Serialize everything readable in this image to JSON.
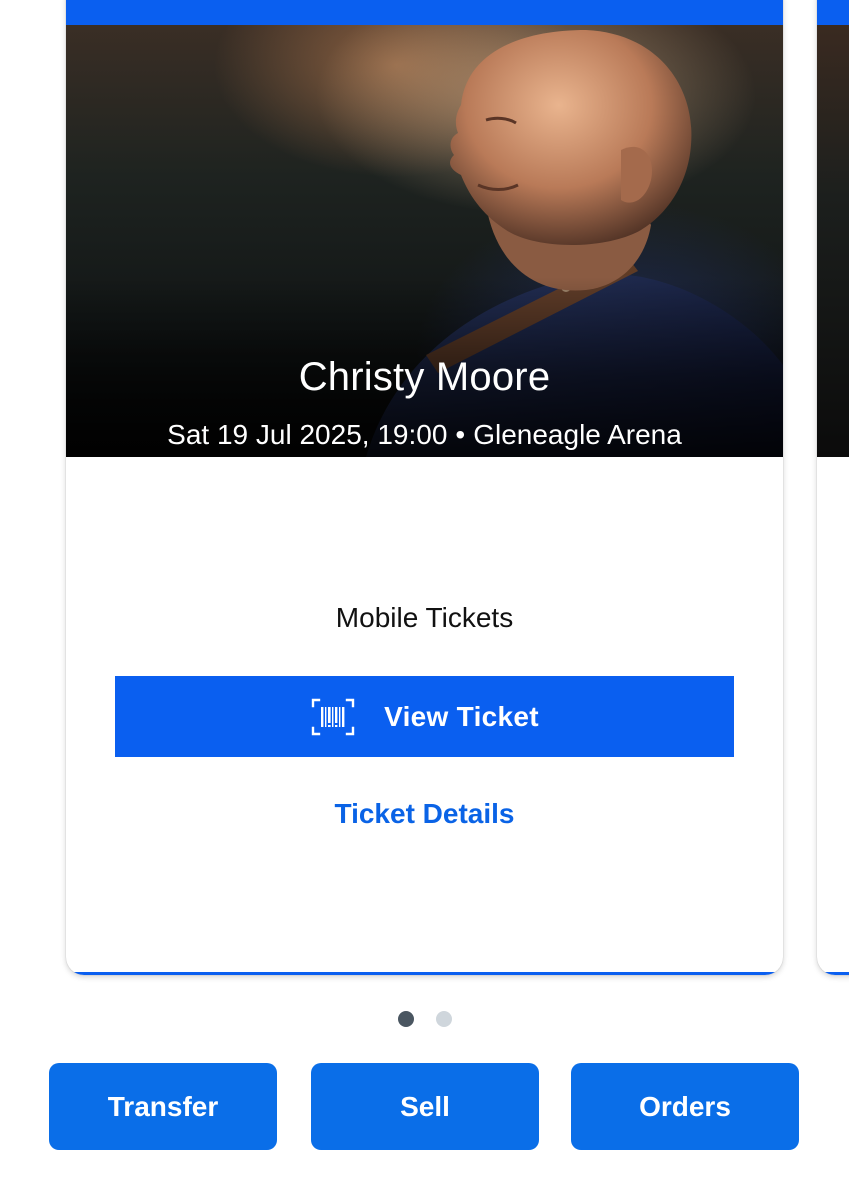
{
  "event": {
    "title": "Christy Moore",
    "datetime": "Sat 19 Jul 2025, 19:00",
    "separator": "•",
    "venue": "Gleneagle Arena"
  },
  "ticket": {
    "type_label": "Mobile Tickets",
    "view_button_label": "View Ticket",
    "view_button_icon": "barcode-scan-icon",
    "details_link_label": "Ticket Details"
  },
  "pager": {
    "current_page": 1,
    "total_pages": 2
  },
  "actions": {
    "transfer_label": "Transfer",
    "sell_label": "Sell",
    "orders_label": "Orders"
  },
  "colors": {
    "accent_blue": "#0a5ff0",
    "button_blue": "#0a6ee8",
    "link_blue": "#0a63e6",
    "pager_active": "#4a5661",
    "pager_inactive": "#cfd6dc"
  }
}
